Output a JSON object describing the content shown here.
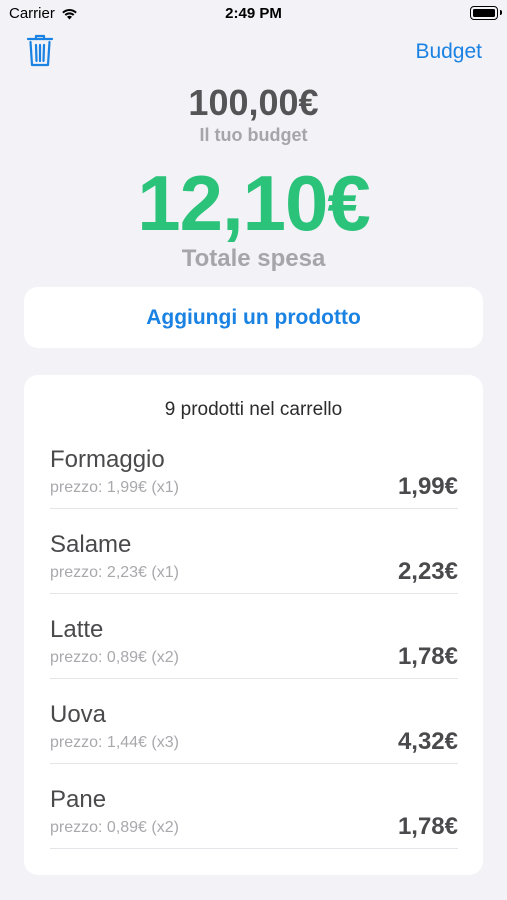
{
  "status_bar": {
    "carrier": "Carrier",
    "time": "2:49 PM"
  },
  "nav": {
    "budget_label": "Budget"
  },
  "budget": {
    "amount": "100,00€",
    "label": "Il tuo budget"
  },
  "total": {
    "amount": "12,10€",
    "label": "Totale spesa"
  },
  "add_button": {
    "label": "Aggiungi un prodotto"
  },
  "cart": {
    "title": "9 prodotti nel carrello",
    "items": [
      {
        "name": "Formaggio",
        "detail": "prezzo: 1,99€ (x1)",
        "total": "1,99€"
      },
      {
        "name": "Salame",
        "detail": "prezzo: 2,23€ (x1)",
        "total": "2,23€"
      },
      {
        "name": "Latte",
        "detail": "prezzo: 0,89€ (x2)",
        "total": "1,78€"
      },
      {
        "name": "Uova",
        "detail": "prezzo: 1,44€ (x3)",
        "total": "4,32€"
      },
      {
        "name": "Pane",
        "detail": "prezzo: 0,89€ (x2)",
        "total": "1,78€"
      }
    ]
  },
  "colors": {
    "accent": "#1a82e2",
    "total_green": "#2bc27a",
    "background": "#f2f2f7"
  },
  "icons": {
    "trash": "trash-icon",
    "wifi": "wifi-icon",
    "battery": "battery-icon"
  }
}
